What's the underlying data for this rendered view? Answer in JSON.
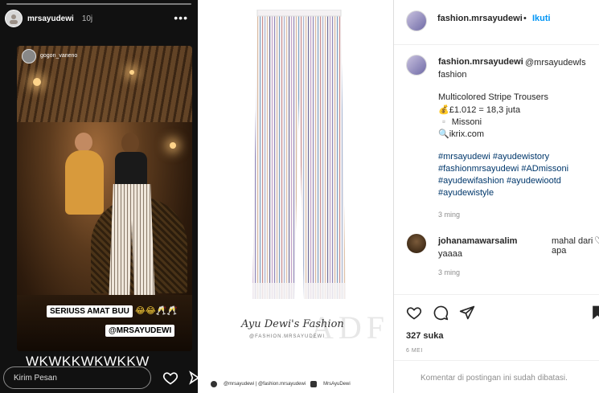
{
  "story": {
    "username": "mrsayudewi",
    "time": "10j",
    "more": "•••",
    "repost_username": "gogon_vaneno",
    "sticker_text_1": "SERIUSS AMAT BUU",
    "sticker_emojis": "😂😂🥂🥂",
    "sticker_text_2": "@MRSAYUDEWI",
    "big_text": "WKWKKWKWKKW",
    "reply_placeholder": "Kirim Pesan"
  },
  "product_image": {
    "watermark_logo": "ADF",
    "watermark_title": "Ayu Dewi's Fashion",
    "watermark_handle": "@FASHION.MRSAYUDEWI",
    "footer": {
      "instagram": "@mrsayudewi | @fashion.mrsayudewi",
      "youtube": "MrsAyuDewi"
    },
    "stripe_colors": [
      "#c4a3c9",
      "#8f86b8",
      "#d8b9a0",
      "#7aa0c4",
      "#c98c8c",
      "#a7b6d2",
      "#e0c2a8",
      "#6f6e9a"
    ]
  },
  "post": {
    "header": {
      "username": "fashion.mrsayudewi",
      "dot": "•",
      "follow_label": "Ikuti"
    },
    "caption": {
      "username": "fashion.mrsayudewi",
      "mention": "@mrsayudewi",
      "mention_suffix": "'s",
      "line1_tail": "fashion",
      "product_name": "Multicolored Stripe Trousers",
      "price": "💰£1.012 = 18,3 juta",
      "brand": "▫️ Missoni",
      "site": "🔍ikrix.com",
      "hashtags": [
        "#mrsayudewi #ayudewistory",
        "#fashionmrsayudewi #ADmissoni",
        "#ayudewifashion #ayudewiootd",
        "#ayudewistyle"
      ],
      "time": "3 ming"
    },
    "comment": {
      "username": "johanamawarsalim",
      "text": "mahal dari apa",
      "text2": "yaaaa",
      "time": "3 ming"
    },
    "likes": "327 suka",
    "date": "6 MEI",
    "comments_disabled": "Komentar di postingan ini sudah dibatasi."
  }
}
